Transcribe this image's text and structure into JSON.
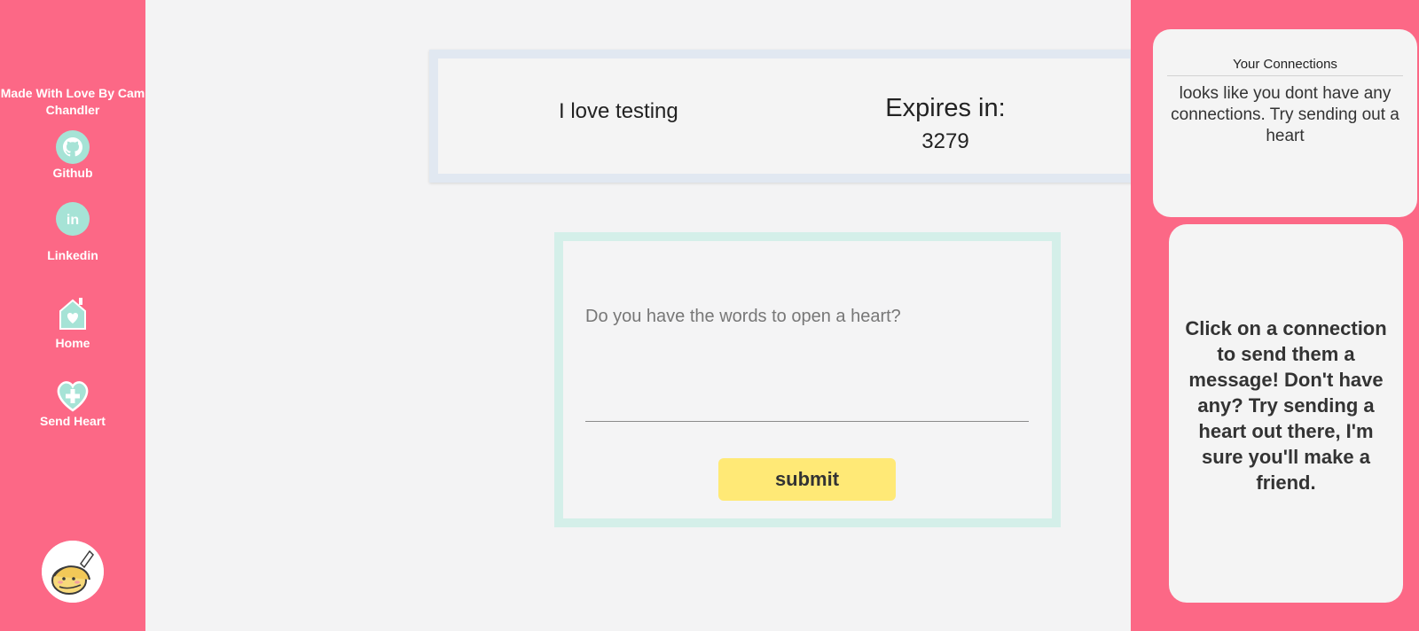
{
  "sidebar": {
    "credit": "Made With Love By Cam Chandler",
    "nav": {
      "github": "Github",
      "linkedin": "Linkedin",
      "home": "Home",
      "send_heart": "Send Heart"
    },
    "linkedin_icon_text": "in"
  },
  "heart": {
    "message": "I love testing",
    "expires_label": "Expires in:",
    "expires_value": "3279"
  },
  "compose": {
    "placeholder": "Do you have the words to open a heart?",
    "submit_label": "submit"
  },
  "connections": {
    "title": "Your Connections",
    "empty_text": "looks like you dont have any connections. Try sending out a heart"
  },
  "message_panel": {
    "hint": "Click on a connection to send them a message! Don't have any? Try sending a heart out there, I'm sure you'll make a friend."
  },
  "colors": {
    "brand_pink": "#fc6886",
    "mint": "#a6e3d6",
    "submit_yellow": "#ffe976"
  },
  "icons": {
    "github": "github-icon",
    "linkedin": "linkedin-icon",
    "home": "home-icon",
    "send_heart": "heart-plus-icon",
    "avatar": "avatar-icon"
  }
}
